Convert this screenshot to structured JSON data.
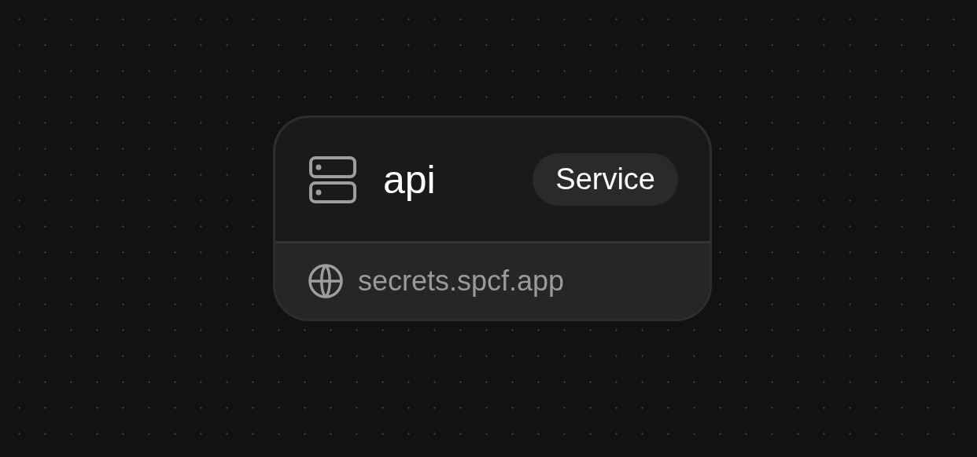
{
  "node": {
    "name": "api",
    "badge": "Service",
    "domain": "secrets.spcf.app"
  }
}
